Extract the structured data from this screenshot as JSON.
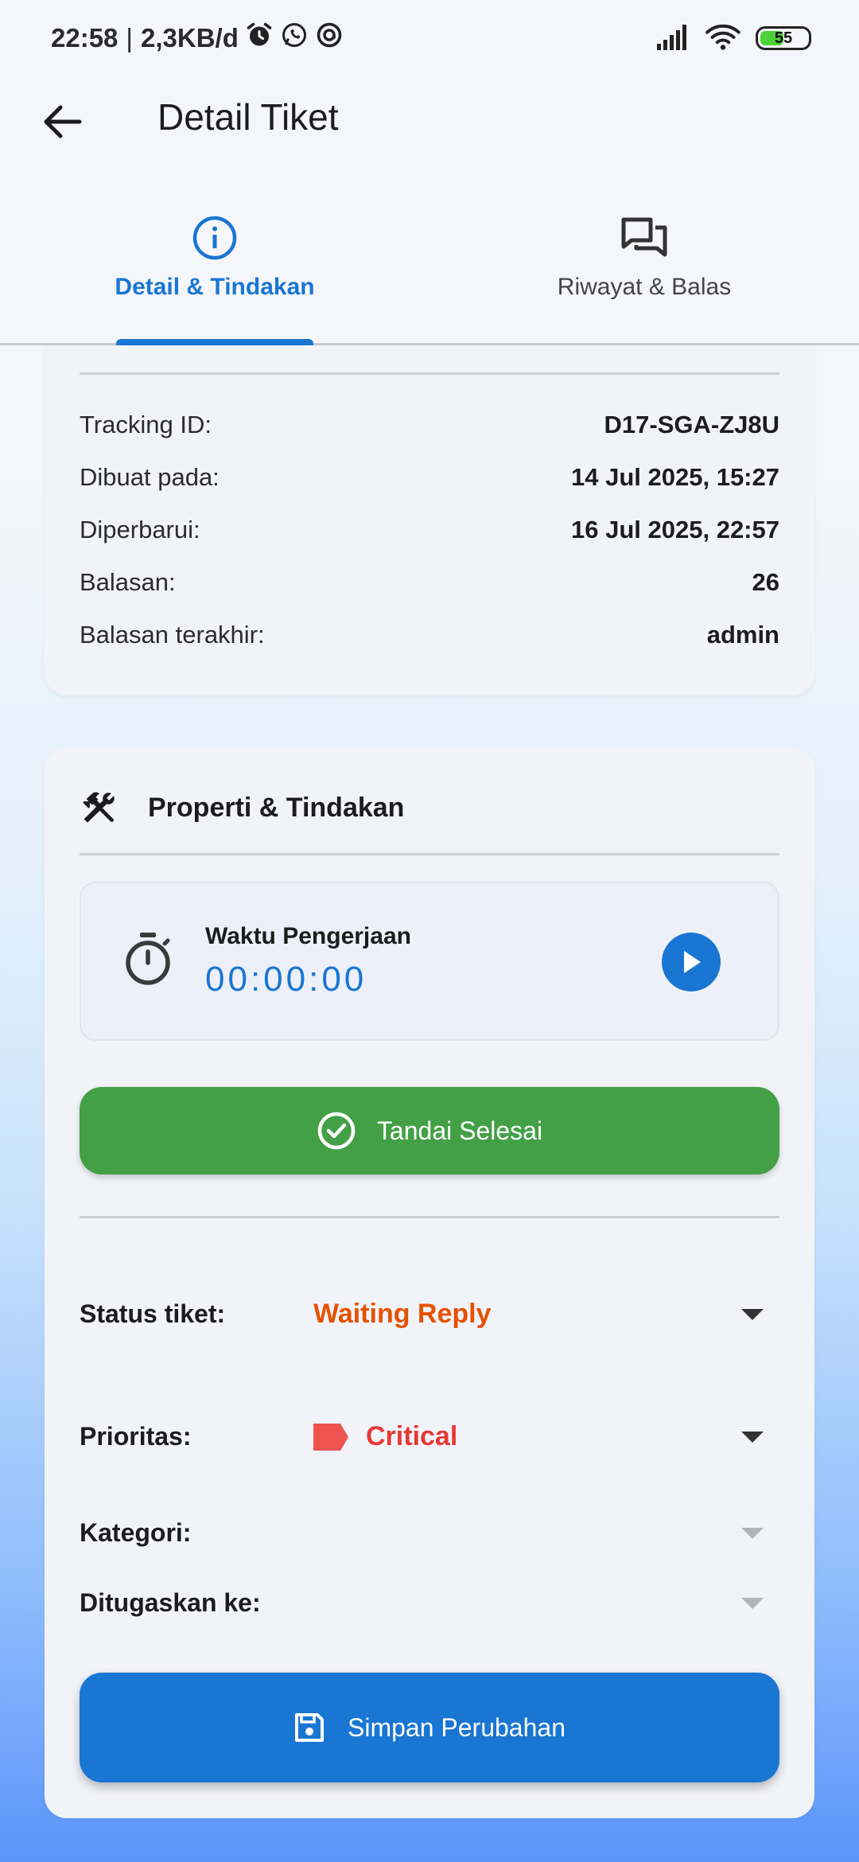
{
  "status_bar": {
    "time": "22:58",
    "separator": "|",
    "data_speed": "2,3KB/d",
    "battery_level": "55",
    "battery_fraction": 0.55
  },
  "app_bar": {
    "title": "Detail Tiket",
    "back_icon": "arrow-left-icon"
  },
  "tabs": [
    {
      "label": "Detail & Tindakan",
      "icon": "info-circle-icon",
      "active": true
    },
    {
      "label": "Riwayat & Balas",
      "icon": "chat-bubbles-icon",
      "active": false
    }
  ],
  "ticket_info": {
    "rows": [
      {
        "label": "Tracking ID:",
        "value": "D17-SGA-ZJ8U"
      },
      {
        "label": "Dibuat pada:",
        "value": "14 Jul 2025, 15:27"
      },
      {
        "label": "Diperbarui:",
        "value": "16 Jul 2025, 22:57"
      },
      {
        "label": "Balasan:",
        "value": "26"
      },
      {
        "label": "Balasan terakhir:",
        "value": "admin"
      }
    ]
  },
  "actions": {
    "title": "Properti & Tindakan",
    "timer": {
      "label": "Waktu Pengerjaan",
      "value": "00:00:00"
    },
    "done_button": "Tandai Selesai",
    "fields": {
      "status": {
        "label": "Status tiket:",
        "value": "Waiting Reply"
      },
      "priority": {
        "label": "Prioritas:",
        "value": "Critical"
      },
      "category": {
        "label": "Kategori:",
        "value": ""
      },
      "assignee": {
        "label": "Ditugaskan ke:",
        "value": ""
      }
    },
    "save_button": "Simpan Perubahan"
  },
  "colors": {
    "accent": "#1976d2",
    "success": "#43a047",
    "status_warning": "#e65100",
    "priority_critical": "#e53935"
  }
}
